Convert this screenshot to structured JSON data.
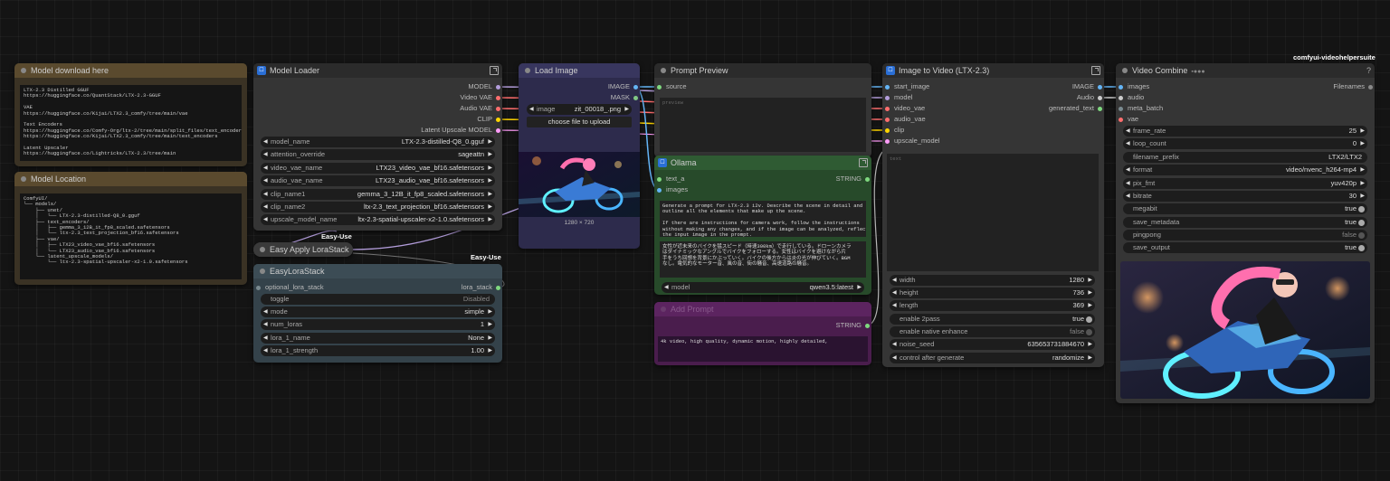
{
  "canvas": {
    "label": "comfyui-videohelpersuite"
  },
  "badges": {
    "easy_use_1": "Easy-Use",
    "easy_use_2": "Easy-Use"
  },
  "model_download": {
    "title": "Model download here",
    "text": "LTX-2.3 Distilled GGUF\nhttps://huggingface.co/QuantStack/LTX-2.3-GGUF\n\nVAE\nhttps://huggingface.co/Kijai/LTX2.3_comfy/tree/main/vae\n\nText Encoders\nhttps://huggingface.co/Comfy-Org/ltx-2/tree/main/split_files/text_encoders\nhttps://huggingface.co/Kijai/LTX2.3_comfy/tree/main/text_encoders\n\nLatent Upscaler\nhttps://huggingface.co/Lightricks/LTX-2.3/tree/main"
  },
  "model_location": {
    "title": "Model Location",
    "text": "ComfyUI/\n└── models/\n    ├── unet/\n    │   └── LTX-2.3-distilled-Q8_0.gguf\n    ├── text_encoders/\n    │   ├── gemma_3_12B_it_fp8_scaled.safetensors\n    │   └── ltx-2.3_text_projection_bf16.safetensors\n    ├── vae/\n    │   ├── LTX23_video_vae_bf16.safetensors\n    │   └── LTX23_audio_vae_bf16.safetensors\n    └── latent_upscale_models/\n        └── ltx-2.3-spatial-upscaler-x2-1.0.safetensors"
  },
  "model_loader": {
    "title": "Model Loader",
    "outputs": [
      "MODEL",
      "Video VAE",
      "Audio VAE",
      "CLIP",
      "Latent Upscale MODEL"
    ],
    "widgets": [
      {
        "label": "model_name",
        "value": "LTX-2.3-distilled-Q8_0.gguf"
      },
      {
        "label": "attention_override",
        "value": "sageattn"
      },
      {
        "label": "video_vae_name",
        "value": "LTX23_video_vae_bf16.safetensors"
      },
      {
        "label": "audio_vae_name",
        "value": "LTX23_audio_vae_bf16.safetensors"
      },
      {
        "label": "clip_name1",
        "value": "gemma_3_12B_it_fp8_scaled.safetensors"
      },
      {
        "label": "clip_name2",
        "value": "ltx-2.3_text_projection_bf16.safetensors"
      },
      {
        "label": "upscale_model_name",
        "value": "ltx-2.3-spatial-upscaler-x2-1.0.safetensors"
      }
    ]
  },
  "apply_lora": {
    "title": "Easy Apply LoraStack"
  },
  "lora_stack": {
    "title": "EasyLoraStack",
    "input": "optional_lora_stack",
    "output": "lora_stack",
    "widgets": [
      {
        "label": "toggle",
        "value": "Disabled"
      },
      {
        "label": "mode",
        "value": "simple"
      },
      {
        "label": "num_loras",
        "value": "1"
      },
      {
        "label": "lora_1_name",
        "value": "None"
      },
      {
        "label": "lora_1_strength",
        "value": "1.00"
      }
    ]
  },
  "load_image": {
    "title": "Load Image",
    "outputs": [
      "IMAGE",
      "MASK"
    ],
    "image_label": "image",
    "image_value": "zit_00018_.png",
    "upload_label": "choose file to upload",
    "dims": "1280 × 720"
  },
  "prompt_preview": {
    "title": "Prompt Preview",
    "input": "source",
    "placeholder": "preview"
  },
  "ollama": {
    "title": "Ollama",
    "inputs": [
      "text_a",
      "images"
    ],
    "output": "STRING",
    "system_text": "Generate a prompt for LTX-2.3 i2v. Describe the scene in detail and\noutline all the elements that make up the scene.\n\nIf there are instructions for camera work, follow the instructions\nwithout making any changes, and if the image can be analyzed, reflect\nthe input image in the prompt.",
    "result_text": "女性が近未来のバイクを猛スピード（時速300km）で走行している。ドローンカメラ\nはダイナミックなアングルでバイクをフォローする。女性はバイクを避けながら片\n手をうち回想を背景にかぶっていく。バイクの後方からは炎の光が伸びていく。BGM\nなし。電気的なモーター音、風の音、街の騒音、高速道路の騒音。",
    "model_label": "model",
    "model_value": "qwen3.5:latest"
  },
  "add_prompt": {
    "title": "Add Prompt",
    "output": "STRING",
    "text": "4k video, high quality, dynamic motion, highly detailed,"
  },
  "i2v": {
    "title": "Image to Video (LTX-2.3)",
    "inputs": [
      "start_image",
      "model",
      "video_vae",
      "audio_vae",
      "clip",
      "upscale_model"
    ],
    "outputs": [
      "IMAGE",
      "Audio",
      "generated_text"
    ],
    "text_placeholder": "text",
    "widgets": [
      {
        "label": "width",
        "value": "1280",
        "kind": "num"
      },
      {
        "label": "height",
        "value": "736",
        "kind": "num"
      },
      {
        "label": "length",
        "value": "369",
        "kind": "num"
      },
      {
        "label": "enable 2pass",
        "value": "true",
        "kind": "toggle"
      },
      {
        "label": "enable native enhance",
        "value": "false",
        "kind": "toggle"
      },
      {
        "label": "noise_seed",
        "value": "635653731884670",
        "kind": "num"
      },
      {
        "label": "control after generate",
        "value": "randomize",
        "kind": "num"
      }
    ]
  },
  "video_combine": {
    "title": "Video Combine",
    "inputs": [
      "images",
      "audio",
      "meta_batch",
      "vae"
    ],
    "output": "Filenames",
    "widgets": [
      {
        "label": "frame_rate",
        "value": "25",
        "kind": "num"
      },
      {
        "label": "loop_count",
        "value": "0",
        "kind": "num"
      },
      {
        "label": "filename_prefix",
        "value": "LTX2/LTX2",
        "kind": "text"
      },
      {
        "label": "format",
        "value": "video/nvenc_h264-mp4",
        "kind": "num"
      },
      {
        "label": "pix_fmt",
        "value": "yuv420p",
        "kind": "num"
      },
      {
        "label": "bitrate",
        "value": "30",
        "kind": "num"
      },
      {
        "label": "megabit",
        "value": "true",
        "kind": "toggle"
      },
      {
        "label": "save_metadata",
        "value": "true",
        "kind": "toggle"
      },
      {
        "label": "pingpong",
        "value": "false",
        "kind": "toggle"
      },
      {
        "label": "save_output",
        "value": "true",
        "kind": "toggle"
      }
    ]
  },
  "colors": {
    "model": "#b39ddb",
    "vae": "#ff6e6e",
    "clip": "#ffd500",
    "latent": "#ff9cf9",
    "image": "#64b5f6",
    "mask": "#81c784",
    "string": "#7fd87f",
    "audio": "#cccccc"
  }
}
